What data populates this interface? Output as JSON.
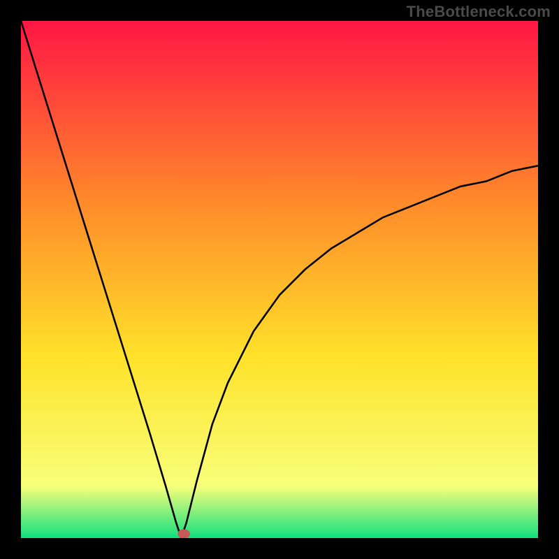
{
  "watermark": "TheBottleneck.com",
  "chart_data": {
    "type": "line",
    "title": "",
    "xlabel": "",
    "ylabel": "",
    "xlim": [
      0,
      100
    ],
    "ylim": [
      0,
      100
    ],
    "grid": false,
    "curve": {
      "__comment": "Piecewise curve with a sharp minimum near x≈31. Left branch plunges from near top-left to the minimum; right branch rises with decreasing slope toward top-right, ending around y≈72 at x=100.",
      "x": [
        0,
        5,
        10,
        15,
        20,
        25,
        28,
        30,
        31,
        32,
        34,
        37,
        40,
        45,
        50,
        55,
        60,
        65,
        70,
        75,
        80,
        85,
        90,
        95,
        100
      ],
      "y": [
        100,
        84,
        68,
        52,
        36,
        20,
        10,
        3,
        0,
        3,
        11,
        22,
        30,
        40,
        47,
        52,
        56,
        59,
        62,
        64,
        66,
        68,
        69,
        71,
        72
      ]
    },
    "marker": {
      "x": 31.5,
      "y": 0.8,
      "color": "#c65a55",
      "r": 1.2
    },
    "bottom_band": {
      "y_from": 0,
      "y_to": 0.6,
      "color": "#13e07f"
    },
    "gradient_colors": {
      "top": "#ff1644",
      "upper_mid": "#ff8a2a",
      "mid": "#ffe22a",
      "lower_mid": "#f7ff7a",
      "bottom": "#13e07f"
    },
    "frame_color": "#000000"
  }
}
